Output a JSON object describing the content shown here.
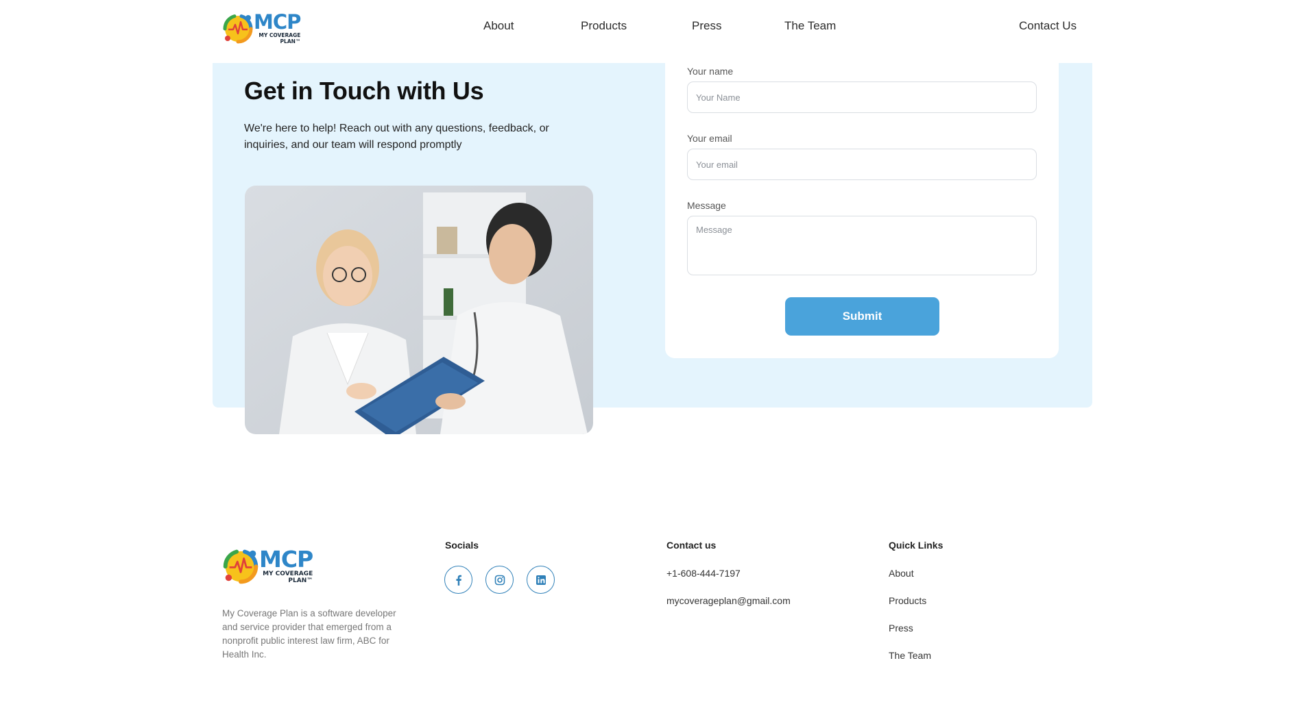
{
  "brand": {
    "name": "MCP",
    "tagline": "MY COVERAGE",
    "tagline2": "PLAN™"
  },
  "colors": {
    "brand_blue": "#2e86c8",
    "panel_bg": "#e4f4fd",
    "button": "#4aa3db",
    "social_ring": "#2f80b8"
  },
  "nav": {
    "items": [
      {
        "label": "About"
      },
      {
        "label": "Products"
      },
      {
        "label": "Press"
      },
      {
        "label": "The Team"
      },
      {
        "label": "Contact Us"
      }
    ]
  },
  "hero": {
    "title": "Get in Touch with Us",
    "text": "We're here to help! Reach out with any questions, feedback, or inquiries, and our team will respond promptly",
    "image": "two-doctors-reviewing-clipboard"
  },
  "form": {
    "name_label": "Your name",
    "name_placeholder": "Your Name",
    "email_label": "Your email",
    "email_placeholder": "Your email",
    "message_label": "Message",
    "message_placeholder": "Message",
    "submit_label": "Submit"
  },
  "footer": {
    "about": "My Coverage Plan is a software developer and service provider that emerged from a nonprofit public interest law firm, ABC for Health Inc.",
    "socials_title": "Socials",
    "socials": [
      {
        "icon": "facebook-icon"
      },
      {
        "icon": "instagram-icon"
      },
      {
        "icon": "linkedin-icon"
      }
    ],
    "contact_title": "Contact us",
    "phone": "+1-608-444-7197",
    "email": "mycoverageplan@gmail.com",
    "links_title": "Quick Links",
    "links": [
      {
        "label": "About"
      },
      {
        "label": "Products"
      },
      {
        "label": "Press"
      },
      {
        "label": "The Team"
      }
    ]
  }
}
